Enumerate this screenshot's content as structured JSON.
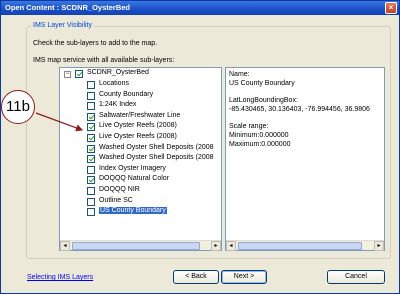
{
  "window": {
    "title": "Open Content : SCDNR_OysterBed",
    "close_glyph": "×"
  },
  "group": {
    "title": "IMS Layer Visibility",
    "instruction": "Check the sub-layers to add to the map.",
    "list_caption": "IMS map service with all available sub-layers:"
  },
  "tree": {
    "root": {
      "label": "SCDNR_OysterBed",
      "checked": true,
      "expander": "−"
    },
    "items": [
      {
        "label": "Locations",
        "checked": false
      },
      {
        "label": "County Boundary",
        "checked": false
      },
      {
        "label": "1:24K Index",
        "checked": false
      },
      {
        "label": "Saltwater/Freshwater Line",
        "checked": true
      },
      {
        "label": "Live Oyster Reefs (2008)",
        "checked": true
      },
      {
        "label": "Live Oyster Reefs (2008)",
        "checked": true
      },
      {
        "label": "Washed Oyster Shell Deposits (2008",
        "checked": true
      },
      {
        "label": "Washed Oyster Shell  Deposits (2008",
        "checked": true
      },
      {
        "label": "Index Oyster Imagery",
        "checked": false
      },
      {
        "label": "DOQQQ Natural Color",
        "checked": true
      },
      {
        "label": "DOQQQ NIR",
        "checked": false
      },
      {
        "label": "Outline SC",
        "checked": false
      },
      {
        "label": "US County Boundary",
        "checked": false,
        "selected": true
      }
    ]
  },
  "info": {
    "name_label": "Name:",
    "name_value": "US County Boundary",
    "bbox_label": "LatLongBoundingBox:",
    "bbox_value": "-85.430465, 30.136403, -76.994456, 36.9806",
    "scale_label": "Scale range:",
    "scale_min": "Minimum:0.000000",
    "scale_max": "Maximum:0.000000"
  },
  "scroll": {
    "left": "◂",
    "right": "▸"
  },
  "footer": {
    "help_link": "Selecting IMS Layers",
    "back_label": "< Back",
    "next_label": "Next >",
    "cancel_label": "Cancel"
  },
  "annotation": {
    "callout": "11b",
    "color": "#8b1a1a"
  }
}
